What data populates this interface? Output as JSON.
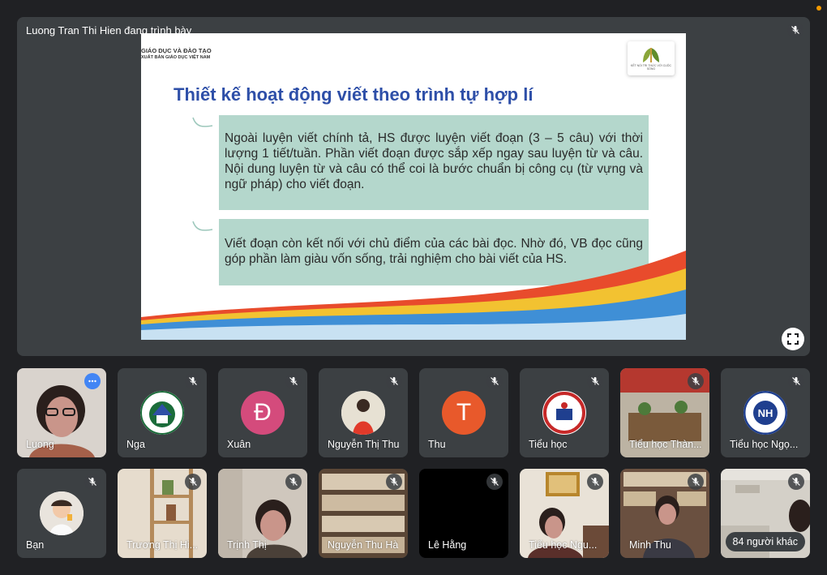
{
  "presentation": {
    "presenter_label": "Luong Tran Thi Hien đang trình bày"
  },
  "slide": {
    "header_line1": "GIÁO DỤC VÀ ĐÀO TẠO",
    "header_line2": "XUẤT BẢN GIÁO DỤC VIỆT NAM",
    "logo_text": "KẾT NỐI TRI THỨC VỚI CUỘC SỐNG",
    "title": "Thiết kế hoạt động viết theo trình tự hợp lí",
    "paragraph1": "Ngoài luyện viết chính tả, HS được luyện viết đoạn (3 – 5 câu) với thời lượng 1 tiết/tuần. Phần viết đoạn được sắp xếp ngay sau luyện từ và câu. Nội dung luyện từ và câu có thể coi là bước chuẩn bị công cụ (từ vựng và ngữ pháp) cho viết đoạn.",
    "paragraph2": "Viết đoạn còn kết nối với chủ điểm của các bài đọc. Nhờ đó, VB đọc cũng góp phần làm giàu vốn sống, trải nghiệm cho bài viết của HS."
  },
  "participants": [
    {
      "name": "Luong"
    },
    {
      "name": "Nga"
    },
    {
      "name": "Xuân",
      "initial": "Đ"
    },
    {
      "name": "Nguyễn Thị Thu"
    },
    {
      "name": "Thu",
      "initial": "T"
    },
    {
      "name": "Tiểu học"
    },
    {
      "name": "Tiểu học Thàn..."
    },
    {
      "name": "Tiểu học Ngọ..."
    },
    {
      "name": "Bạn"
    },
    {
      "name": "Trương Thị Hi..."
    },
    {
      "name": "Trịnh Thị"
    },
    {
      "name": "Nguyễn Thu Hà"
    },
    {
      "name": "Lê Hằng"
    },
    {
      "name": "Tiểu học Ngu..."
    },
    {
      "name": "Minh Thu"
    }
  ],
  "others_count_label": "84 người khác",
  "colors": {
    "background": "#202124",
    "tile": "#3c4043",
    "slide_title": "#2e4fa8",
    "content_box": "#b4d7cc",
    "avatar_d": "#d44b7c",
    "avatar_t": "#e8592b"
  }
}
